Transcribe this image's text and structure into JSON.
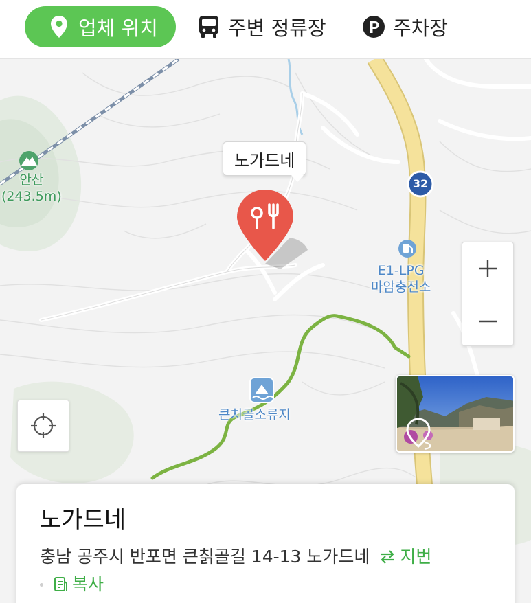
{
  "tabs": [
    {
      "label": "업체 위치",
      "icon": "location-pin-icon",
      "active": true
    },
    {
      "label": "주변 정류장",
      "icon": "bus-icon",
      "active": false
    },
    {
      "label": "주차장",
      "icon": "parking-icon",
      "active": false
    }
  ],
  "map": {
    "callout": "노가드네",
    "pin_icon": "restaurant-icon",
    "pin_color": "#e8574a",
    "mountain": {
      "name": "안산",
      "height": "(243.5m)"
    },
    "route_shield": "32",
    "gas_station": {
      "line1": "E1-LPG",
      "line2": "마암충전소"
    },
    "reservoir": "큰치골소류지",
    "zoom_in_icon": "plus-icon",
    "zoom_out_icon": "minus-icon",
    "locate_icon": "crosshair-icon",
    "thumbnail_icon": "street-view-icon",
    "colors": {
      "accent": "#5cc654",
      "road": "#f4d98a",
      "trail": "#7cb342",
      "label_blue": "#4e88c7"
    }
  },
  "card": {
    "title": "노가드네",
    "address": "충남 공주시 반포면 큰칡골길 14-13 노가드네",
    "jibun_label": "지번",
    "copy_label": "복사"
  }
}
